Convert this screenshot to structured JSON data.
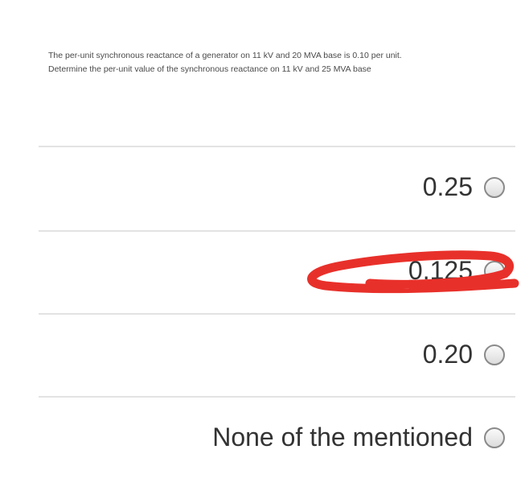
{
  "question": {
    "line1": "The per-unit synchronous reactance of a generator on 11 kV and 20 MVA base is 0.10 per unit.",
    "line2": "Determine the per-unit value of the synchronous reactance on 11 kV and 25 MVA base"
  },
  "options": [
    {
      "label": "0.25"
    },
    {
      "label": "0.125"
    },
    {
      "label": "0.20"
    },
    {
      "label": "None of the mentioned"
    }
  ],
  "colors": {
    "annotation_stroke": "#e8302a",
    "radio_border": "#8a8a8a",
    "divider": "#e3e3e3"
  }
}
